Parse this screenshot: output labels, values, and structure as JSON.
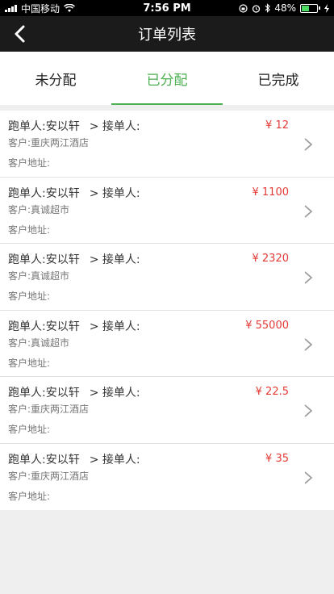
{
  "status_bar": {
    "carrier": "中国移动",
    "time": "7:56 PM",
    "battery_percent": "48%",
    "battery_level": 0.48,
    "icons": [
      "signal-icon",
      "wifi-icon",
      "lock-rotation-icon",
      "alarm-icon",
      "bluetooth-icon",
      "battery-icon",
      "charging-icon"
    ]
  },
  "nav": {
    "title": "订单列表",
    "back_icon": "back-arrow-icon"
  },
  "tabs": [
    {
      "label": "未分配",
      "active": false
    },
    {
      "label": "已分配",
      "active": true
    },
    {
      "label": "已完成",
      "active": false
    }
  ],
  "colors": {
    "accent": "#4caf50",
    "price": "#e53935",
    "nav_bg": "#1b1b1b"
  },
  "orders": [
    {
      "runner": "跑单人:安以轩",
      "receiver": "> 接单人:",
      "customer": "客户:重庆两江酒店",
      "address": "客户地址:",
      "price": "¥ 12"
    },
    {
      "runner": "跑单人:安以轩",
      "receiver": "> 接单人:",
      "customer": "客户:真诚超市",
      "address": "客户地址:",
      "price": "¥ 1100"
    },
    {
      "runner": "跑单人:安以轩",
      "receiver": "> 接单人:",
      "customer": "客户:真诚超市",
      "address": "客户地址:",
      "price": "¥ 2320"
    },
    {
      "runner": "跑单人:安以轩",
      "receiver": "> 接单人:",
      "customer": "客户:真诚超市",
      "address": "客户地址:",
      "price": "¥ 55000"
    },
    {
      "runner": "跑单人:安以轩",
      "receiver": "> 接单人:",
      "customer": "客户:重庆两江酒店",
      "address": "客户地址:",
      "price": "¥ 22.5"
    },
    {
      "runner": "跑单人:安以轩",
      "receiver": "> 接单人:",
      "customer": "客户:重庆两江酒店",
      "address": "客户地址:",
      "price": "¥ 35"
    }
  ]
}
